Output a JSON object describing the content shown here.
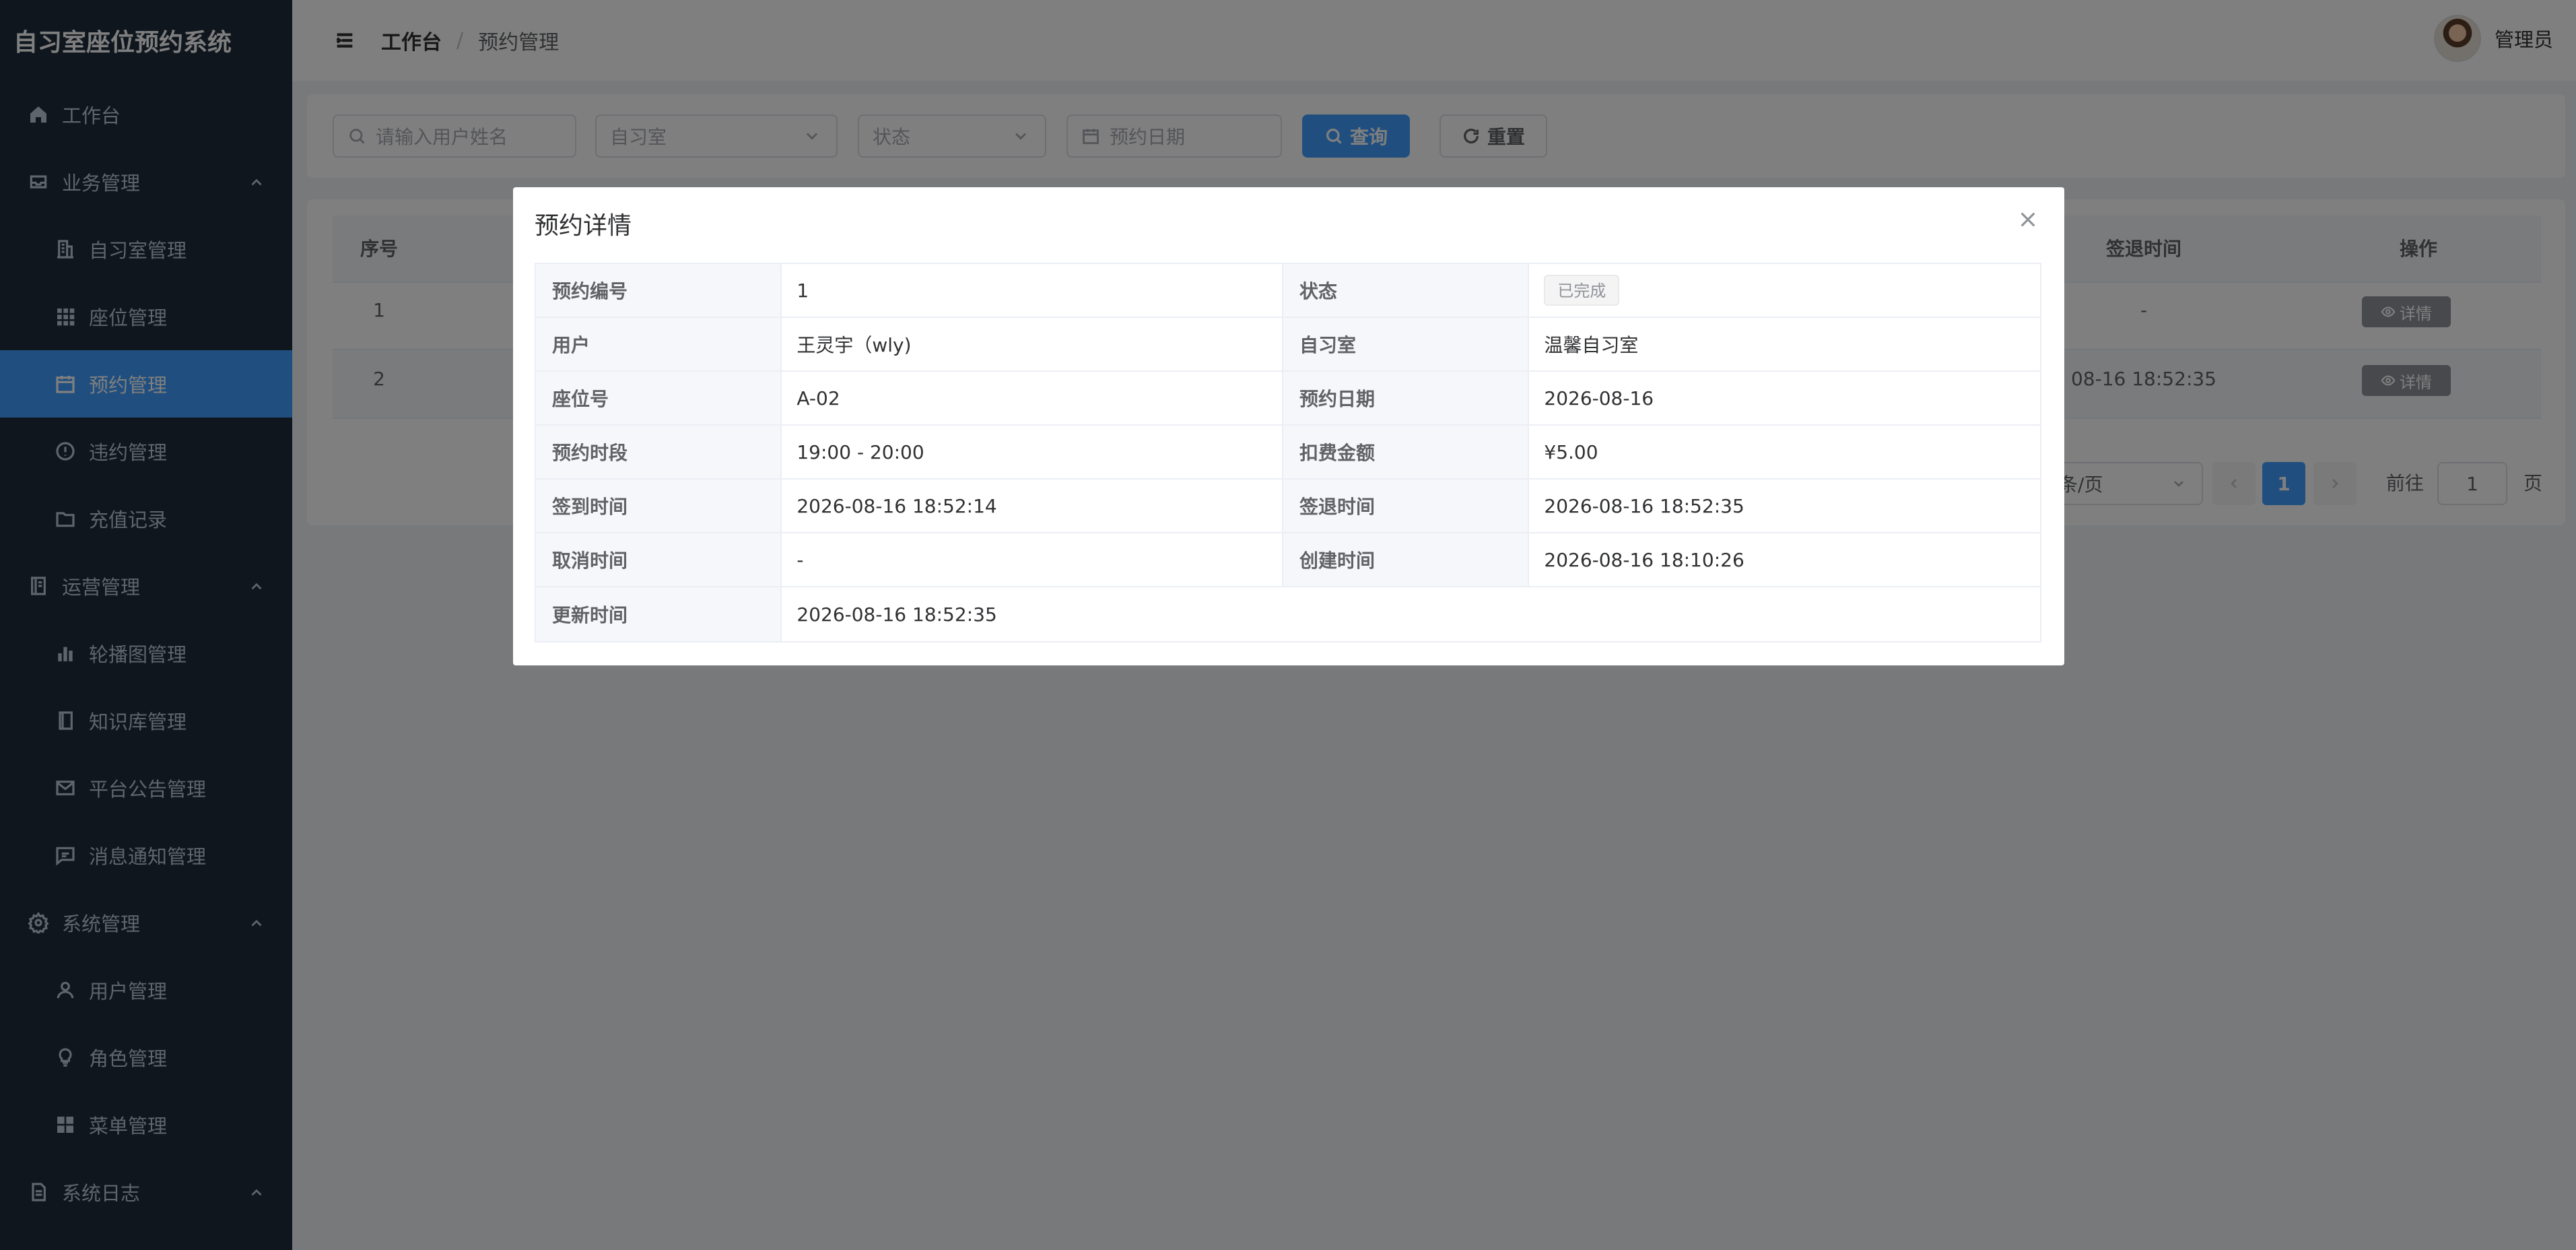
{
  "app": {
    "title": "自习室座位预约系统"
  },
  "sidebar": {
    "items": [
      {
        "label": "工作台",
        "icon": "home-icon"
      },
      {
        "label": "业务管理",
        "icon": "inbox-icon"
      },
      {
        "label": "自习室管理",
        "icon": "office-building-icon"
      },
      {
        "label": "座位管理",
        "icon": "grid-icon"
      },
      {
        "label": "预约管理",
        "icon": "calendar-icon"
      },
      {
        "label": "违约管理",
        "icon": "warning-icon"
      },
      {
        "label": "充值记录",
        "icon": "folder-icon"
      },
      {
        "label": "运营管理",
        "icon": "notebook-icon"
      },
      {
        "label": "轮播图管理",
        "icon": "bar-chart-icon"
      },
      {
        "label": "知识库管理",
        "icon": "book-icon"
      },
      {
        "label": "平台公告管理",
        "icon": "message-icon"
      },
      {
        "label": "消息通知管理",
        "icon": "chat-icon"
      },
      {
        "label": "系统管理",
        "icon": "setting-icon"
      },
      {
        "label": "用户管理",
        "icon": "user-icon"
      },
      {
        "label": "角色管理",
        "icon": "lightbulb-icon"
      },
      {
        "label": "菜单管理",
        "icon": "menu-grid-icon"
      },
      {
        "label": "系统日志",
        "icon": "document-icon"
      }
    ],
    "active": "预约管理"
  },
  "header": {
    "breadcrumb": [
      "工作台",
      "预约管理"
    ],
    "separator": "/",
    "username": "管理员"
  },
  "search": {
    "user_placeholder": "请输入用户姓名",
    "room_placeholder": "自习室",
    "status_placeholder": "状态",
    "date_placeholder": "预约日期",
    "query_label": "查询",
    "reset_label": "重置"
  },
  "table": {
    "headers": {
      "index": "序号",
      "checkout_time": "签退时间",
      "actions": "操作"
    },
    "rows": [
      {
        "index": "1",
        "checkout_time": "-",
        "action": "详情"
      },
      {
        "index": "2",
        "checkout_time": "08-16 18:52:35",
        "action": "详情"
      }
    ]
  },
  "pagination": {
    "page_size_label": "条/页",
    "current_page": "1",
    "goto_label": "前往",
    "goto_value": "1",
    "page_suffix": "页"
  },
  "dialog": {
    "title": "预约详情",
    "fields": {
      "reservation_no_label": "预约编号",
      "reservation_no": "1",
      "status_label": "状态",
      "status": "已完成",
      "user_label": "用户",
      "user": "王灵宇（wly)",
      "room_label": "自习室",
      "room": "温馨自习室",
      "seat_label": "座位号",
      "seat": "A-02",
      "date_label": "预约日期",
      "date": "2026-08-16",
      "slot_label": "预约时段",
      "slot": "19:00 - 20:00",
      "fee_label": "扣费金额",
      "fee": "¥5.00",
      "checkin_label": "签到时间",
      "checkin": "2026-08-16 18:52:14",
      "checkout_label": "签退时间",
      "checkout": "2026-08-16 18:52:35",
      "cancel_label": "取消时间",
      "cancel": "-",
      "created_label": "创建时间",
      "created": "2026-08-16 18:10:26",
      "updated_label": "更新时间",
      "updated": "2026-08-16 18:52:35"
    }
  },
  "colors": {
    "sidebar_bg": "#1f2d3d",
    "primary": "#409eff",
    "overlay": "rgba(0,0,0,0.5)",
    "info_button": "#909399"
  }
}
